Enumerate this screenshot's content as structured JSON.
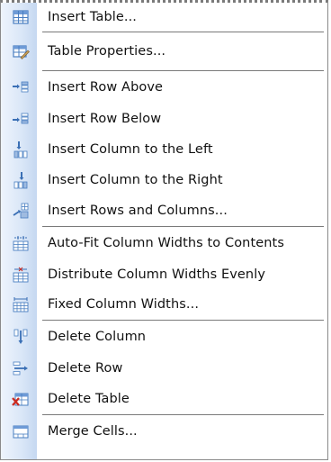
{
  "menu": {
    "items": [
      {
        "label": "Insert Table...",
        "icon": "insert-table-icon"
      },
      {
        "label": "Table Properties...",
        "icon": "table-properties-icon"
      },
      {
        "label": "Insert Row Above",
        "icon": "insert-row-above-icon"
      },
      {
        "label": "Insert Row Below",
        "icon": "insert-row-below-icon"
      },
      {
        "label": "Insert Column to the Left",
        "icon": "insert-column-left-icon"
      },
      {
        "label": "Insert Column to the Right",
        "icon": "insert-column-right-icon"
      },
      {
        "label": "Insert Rows and Columns...",
        "icon": "insert-rows-columns-icon"
      },
      {
        "label": "Auto-Fit Column Widths to Contents",
        "icon": "autofit-column-widths-icon"
      },
      {
        "label": "Distribute Column Widths Evenly",
        "icon": "distribute-column-widths-icon"
      },
      {
        "label": "Fixed Column Widths...",
        "icon": "fixed-column-widths-icon"
      },
      {
        "label": "Delete Column",
        "icon": "delete-column-icon"
      },
      {
        "label": "Delete Row",
        "icon": "delete-row-icon"
      },
      {
        "label": "Delete Table",
        "icon": "delete-table-icon"
      },
      {
        "label": "Merge Cells...",
        "icon": "merge-cells-icon"
      }
    ]
  },
  "colors": {
    "gutter": "#d9e6f7",
    "separator": "#7a7a7a",
    "icon_blue": "#4a7fc1",
    "icon_red": "#cc2a1f"
  }
}
